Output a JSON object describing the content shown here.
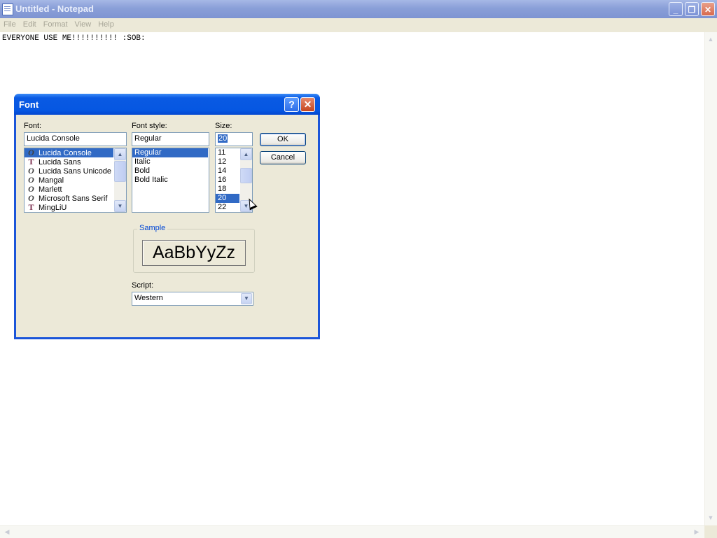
{
  "window": {
    "title": "Untitled - Notepad",
    "min_label": "_",
    "max_label": "❐",
    "close_label": "✕"
  },
  "menu": {
    "items": [
      "File",
      "Edit",
      "Format",
      "View",
      "Help"
    ]
  },
  "editor": {
    "text": "EVERYONE USE ME!!!!!!!!!! :SOB:"
  },
  "dialog": {
    "title": "Font",
    "help_label": "?",
    "close_label": "✕",
    "font": {
      "label": "Font:",
      "value": "Lucida Console",
      "items": [
        {
          "name": "Lucida Console",
          "icon": "opentype-icon",
          "selected": true
        },
        {
          "name": "Lucida Sans",
          "icon": "truetype-icon"
        },
        {
          "name": "Lucida Sans Unicode",
          "icon": "opentype-icon"
        },
        {
          "name": "Mangal",
          "icon": "opentype-icon"
        },
        {
          "name": "Marlett",
          "icon": "opentype-icon"
        },
        {
          "name": "Microsoft Sans Serif",
          "icon": "opentype-icon"
        },
        {
          "name": "MingLiU",
          "icon": "truetype-icon"
        }
      ]
    },
    "style": {
      "label": "Font style:",
      "value": "Regular",
      "items": [
        {
          "name": "Regular",
          "selected": true
        },
        {
          "name": "Italic"
        },
        {
          "name": "Bold"
        },
        {
          "name": "Bold Italic"
        }
      ]
    },
    "size": {
      "label": "Size:",
      "value": "20",
      "items": [
        {
          "name": "11"
        },
        {
          "name": "12"
        },
        {
          "name": "14"
        },
        {
          "name": "16"
        },
        {
          "name": "18"
        },
        {
          "name": "20",
          "selected": true
        },
        {
          "name": "22"
        }
      ]
    },
    "ok_label": "OK",
    "cancel_label": "Cancel",
    "sample": {
      "label": "Sample",
      "text": "AaBbYyZz"
    },
    "script": {
      "label": "Script:",
      "value": "Western"
    }
  }
}
